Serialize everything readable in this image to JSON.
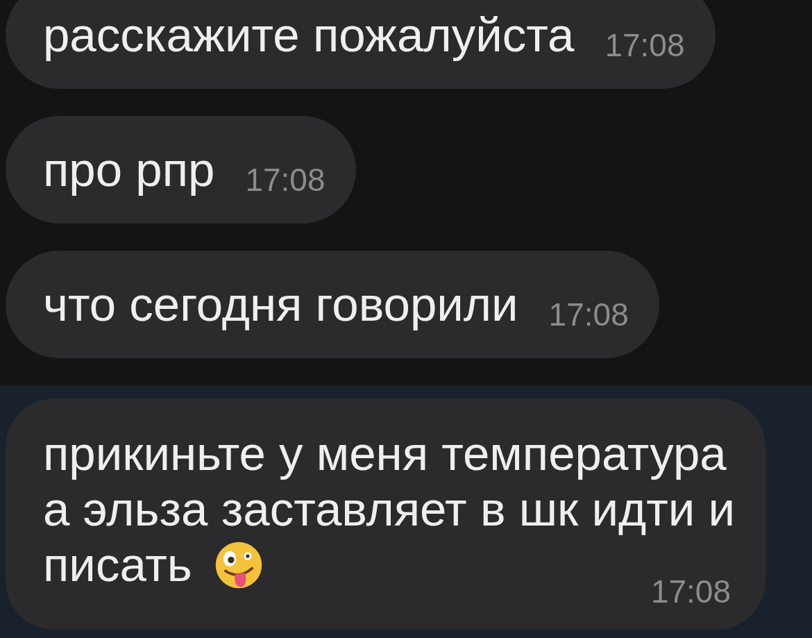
{
  "messages": [
    {
      "lines": [
        "расскажите пожалуйста"
      ],
      "time": "17:08",
      "highlighted": false,
      "emoji": false
    },
    {
      "lines": [
        "про рпр"
      ],
      "time": "17:08",
      "highlighted": false,
      "emoji": false
    },
    {
      "lines": [
        "что сегодня говорили"
      ],
      "time": "17:08",
      "highlighted": false,
      "emoji": false
    },
    {
      "lines": [
        "прикиньте у меня температура",
        "а эльза заставляет в шк идти и",
        "писать"
      ],
      "time": "17:08",
      "highlighted": true,
      "emoji": true
    }
  ]
}
